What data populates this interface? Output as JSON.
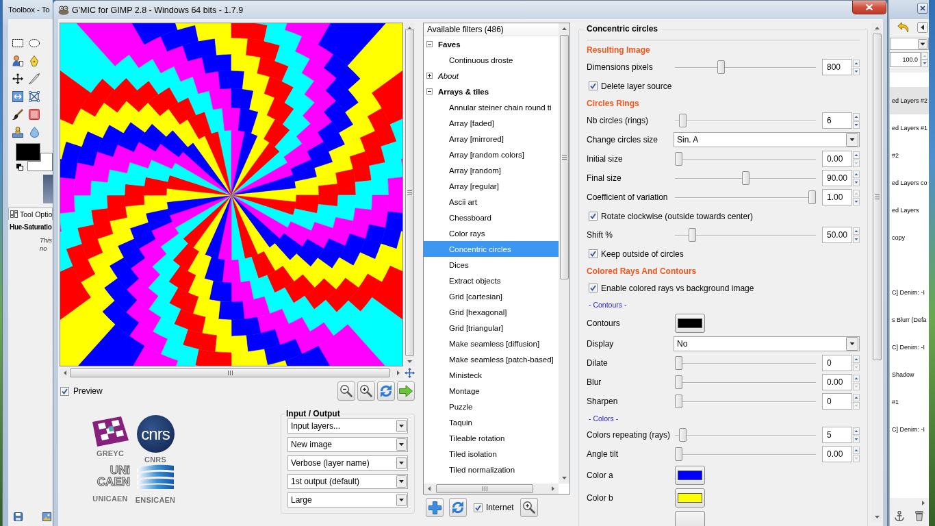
{
  "toolbox": {
    "title": "Toolbox - To",
    "swatches": [
      {
        "kind": "foreground",
        "color": "#000000"
      },
      {
        "kind": "background",
        "color": "#ffffff"
      }
    ],
    "tab": "Tool Optio",
    "tool": "Hue-Saturatio",
    "hint": [
      "This",
      "no"
    ]
  },
  "window": {
    "title": "G'MIC for GIMP 2.8 - Windows 64 bits - 1.7.9"
  },
  "preview": {
    "label": "Preview",
    "checked": true
  },
  "logos": [
    {
      "kind": "tiles",
      "caption": "GREYC"
    },
    {
      "kind": "circle",
      "mark": [
        "cnrs"
      ],
      "caption": "CNRS"
    },
    {
      "kind": "letters",
      "mark": [
        "UNi",
        "CAEN"
      ],
      "caption": "UNICAEN"
    },
    {
      "kind": "stripes",
      "caption": "ENSICAEN"
    }
  ],
  "input_output": {
    "title": "Input / Output",
    "selects": [
      "Input layers...",
      "New image",
      "Verbose (layer name)",
      "1st output (default)",
      "Large"
    ]
  },
  "filters": {
    "header": "Available filters (486)",
    "tree": [
      {
        "label": "Faves",
        "kind": "folder",
        "expanded": true,
        "selected": false,
        "children": [
          {
            "label": "Continuous droste",
            "selected": false
          }
        ]
      },
      {
        "label": "About",
        "kind": "info",
        "expanded": false,
        "selected": false
      },
      {
        "label": "Arrays & tiles",
        "kind": "folder",
        "expanded": true,
        "selected": false,
        "children": [
          {
            "label": "Annular steiner chain round ti",
            "selected": false
          },
          {
            "label": "Array [faded]",
            "selected": false
          },
          {
            "label": "Array [mirrored]",
            "selected": false
          },
          {
            "label": "Array [random colors]",
            "selected": false
          },
          {
            "label": "Array [random]",
            "selected": false
          },
          {
            "label": "Array [regular]",
            "selected": false
          },
          {
            "label": "Ascii art",
            "selected": false
          },
          {
            "label": "Chessboard",
            "selected": false
          },
          {
            "label": "Color rays",
            "selected": false
          },
          {
            "label": "Concentric circles",
            "selected": true
          },
          {
            "label": "Dices",
            "selected": false
          },
          {
            "label": "Extract objects",
            "selected": false
          },
          {
            "label": "Grid [cartesian]",
            "selected": false
          },
          {
            "label": "Grid [hexagonal]",
            "selected": false
          },
          {
            "label": "Grid [triangular]",
            "selected": false
          },
          {
            "label": "Make seamless [diffusion]",
            "selected": false
          },
          {
            "label": "Make seamless [patch-based]",
            "selected": false
          },
          {
            "label": "Ministeck",
            "selected": false
          },
          {
            "label": "Montage",
            "selected": false
          },
          {
            "label": "Puzzle",
            "selected": false
          },
          {
            "label": "Taquin",
            "selected": false
          },
          {
            "label": "Tileable rotation",
            "selected": false
          },
          {
            "label": "Tiled isolation",
            "selected": false
          },
          {
            "label": "Tiled normalization",
            "selected": false
          }
        ]
      }
    ],
    "internet": {
      "label": "Internet",
      "checked": true
    }
  },
  "parameters": {
    "title": "Concentric circles",
    "items": [
      {
        "kind": "section",
        "label": "Resulting Image"
      },
      {
        "kind": "slider",
        "label": "Dimensions pixels",
        "level": 0.32,
        "value": "800"
      },
      {
        "kind": "checkbox",
        "label": "Delete layer source",
        "checked": true
      },
      {
        "kind": "section",
        "label": "Circles Rings"
      },
      {
        "kind": "slider",
        "label": "Nb circles (rings)",
        "level": 0.03,
        "value": "6"
      },
      {
        "kind": "select",
        "label": "Change circles size",
        "value": "Sin. A"
      },
      {
        "kind": "slider",
        "label": "Initial size",
        "level": 0,
        "value": "0.00"
      },
      {
        "kind": "slider",
        "label": "Final size",
        "level": 0.5,
        "value": "90.00"
      },
      {
        "kind": "slider",
        "label": "Coefficient of variation",
        "level": 1,
        "value": "1.00"
      },
      {
        "kind": "checkbox",
        "label": "Rotate clockwise (outside towards center)",
        "checked": true
      },
      {
        "kind": "slider",
        "label": "Shift %",
        "level": 0.1,
        "value": "50.00"
      },
      {
        "kind": "checkbox",
        "label": "Keep outside of circles",
        "checked": true
      },
      {
        "kind": "section",
        "label": "Colored Rays And Contours"
      },
      {
        "kind": "checkbox",
        "label": "Enable colored rays vs background image",
        "checked": true
      },
      {
        "kind": "note",
        "label": "- Contours -"
      },
      {
        "kind": "color",
        "label": "Contours",
        "color": "#000000"
      },
      {
        "kind": "select",
        "label": "Display",
        "value": "No"
      },
      {
        "kind": "slider",
        "label": "Dilate",
        "level": 0,
        "value": "0"
      },
      {
        "kind": "slider",
        "label": "Blur",
        "level": 0,
        "value": "0.00"
      },
      {
        "kind": "slider",
        "label": "Sharpen",
        "level": 0,
        "value": "0"
      },
      {
        "kind": "note",
        "label": "- Colors -"
      },
      {
        "kind": "slider",
        "label": "Colors repeating (rays)",
        "level": 0.03,
        "value": "5"
      },
      {
        "kind": "slider",
        "label": "Angle tilt",
        "level": 0,
        "value": "0.00"
      },
      {
        "kind": "color",
        "label": "Color a",
        "color": "#0000ff"
      },
      {
        "kind": "color",
        "label": "Color b",
        "color": "#ffff00"
      },
      {
        "kind": "color"
      }
    ]
  },
  "layers_dock": {
    "opacity": "100.0",
    "layers": [
      {
        "name": "ed Layers #2",
        "selected": true
      },
      {
        "name": "ed Layers #1",
        "selected": false
      },
      {
        "name": "#2",
        "selected": false
      },
      {
        "name": "ed Layers co",
        "selected": false
      },
      {
        "name": "ed Layers",
        "selected": false
      },
      {
        "name": "copy",
        "selected": false
      },
      {
        "selected": false
      },
      {
        "name": "C] Denim: -I",
        "selected": false
      },
      {
        "name": "s Blurr (Defa",
        "selected": false
      },
      {
        "name": "C] Denim: -I",
        "selected": false
      },
      {
        "name": "Shadow",
        "selected": false
      },
      {
        "name": "#1",
        "selected": false
      },
      {
        "name": "C] Denim: -I",
        "selected": false
      }
    ]
  }
}
